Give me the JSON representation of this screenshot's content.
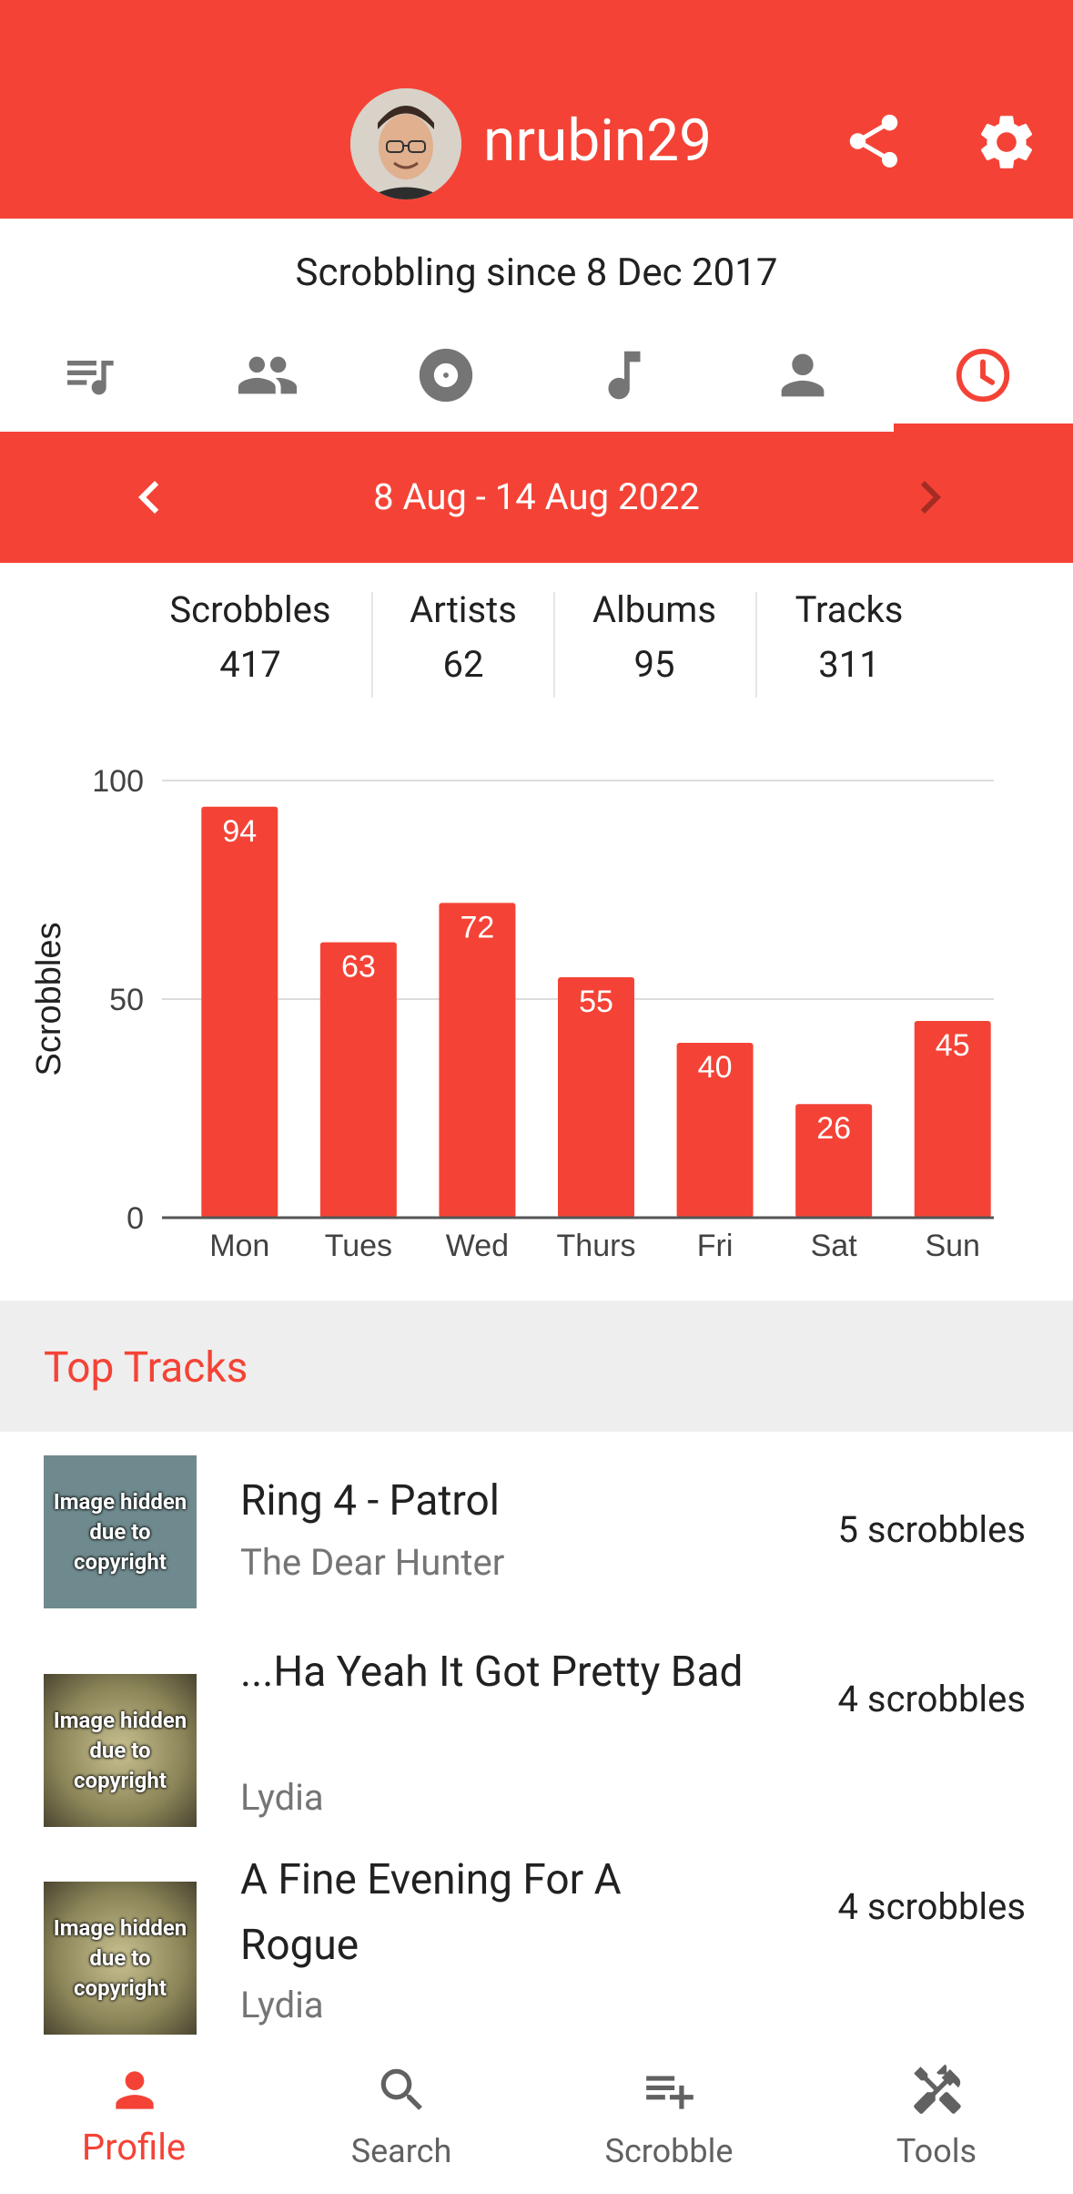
{
  "profile": {
    "username": "nrubin29",
    "since": "Scrobbling since 8 Dec 2017"
  },
  "tabs": [
    {
      "icon": "queue-music-icon"
    },
    {
      "icon": "people-icon"
    },
    {
      "icon": "album-icon"
    },
    {
      "icon": "music-note-icon"
    },
    {
      "icon": "person-icon"
    },
    {
      "icon": "clock-icon",
      "active": true
    }
  ],
  "week": {
    "label": "8 Aug - 14 Aug 2022"
  },
  "stats": [
    {
      "label": "Scrobbles",
      "value": "417"
    },
    {
      "label": "Artists",
      "value": "62"
    },
    {
      "label": "Albums",
      "value": "95"
    },
    {
      "label": "Tracks",
      "value": "311"
    }
  ],
  "chart_data": {
    "type": "bar",
    "categories": [
      "Mon",
      "Tues",
      "Wed",
      "Thurs",
      "Fri",
      "Sat",
      "Sun"
    ],
    "values": [
      94,
      63,
      72,
      55,
      40,
      26,
      45
    ],
    "ylabel": "Scrobbles",
    "ylim": [
      0,
      100
    ],
    "yticks": [
      "0",
      "50",
      "100"
    ],
    "color": "#f44336",
    "grid": true
  },
  "top_tracks": {
    "title": "Top Tracks",
    "placeholder_text": "Image hidden due to copyright",
    "items": [
      {
        "title": "Ring 4 - Patrol",
        "artist": "The Dear Hunter",
        "count": "5 scrobbles"
      },
      {
        "title": "...Ha Yeah It Got Pretty Bad",
        "artist": "Lydia",
        "count": "4 scrobbles"
      },
      {
        "title": "A Fine Evening For A Rogue",
        "artist": "Lydia",
        "count": "4 scrobbles"
      }
    ]
  },
  "nav": {
    "profile": "Profile",
    "search": "Search",
    "scrobble": "Scrobble",
    "tools": "Tools"
  },
  "colors": {
    "accent": "#f44336",
    "icon_gray": "#757575"
  }
}
